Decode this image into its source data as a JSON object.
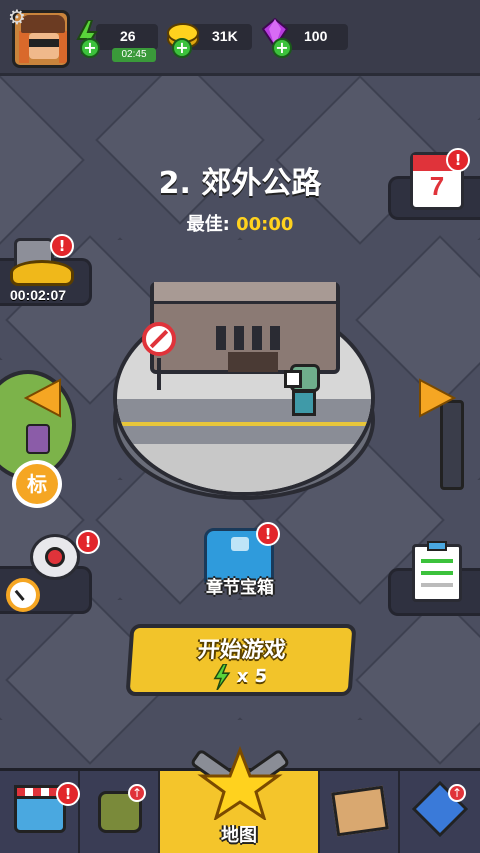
{
  "hud": {
    "energy": "26",
    "energy_timer": "02:45",
    "coins": "31K",
    "gems": "100"
  },
  "level": {
    "title": "2. 郊外公路",
    "best_label": "最佳:",
    "best_time": "00:00"
  },
  "side": {
    "treasure_timer": "00:02:07",
    "calendar_day": "7",
    "tag_label": "标"
  },
  "chest": {
    "label": "章节宝箱"
  },
  "start_button": {
    "label": "开始游戏",
    "cost": "x 5"
  },
  "nav": {
    "active_label": "地图"
  },
  "badge": "!",
  "colors": {
    "accent_yellow": "#f4c52b",
    "badge_red": "#e2262b",
    "plus_green": "#3cc23c",
    "gem_purple": "#b83be0",
    "energy_green": "#59d43a"
  }
}
